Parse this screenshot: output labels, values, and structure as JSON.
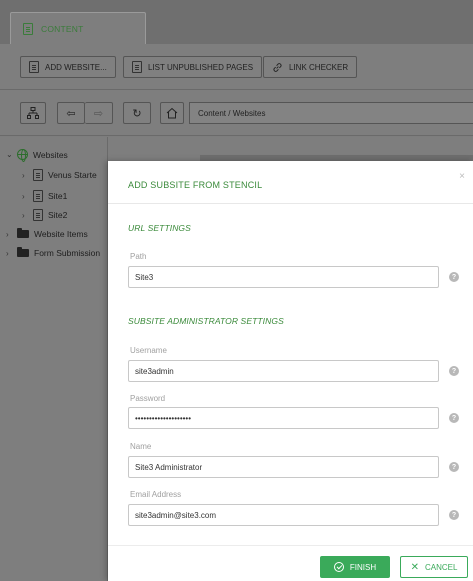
{
  "tabs": [
    {
      "label": "CONTENT"
    }
  ],
  "toolbar": {
    "add_website": "ADD WEBSITE...",
    "list_unpublished": "LIST UNPUBLISHED PAGES",
    "link_checker": "LINK CHECKER"
  },
  "breadcrumb": "Content / Websites",
  "tree": {
    "root": "Websites",
    "children": [
      "Venus Starte",
      "Site1",
      "Site2"
    ],
    "others": [
      "Website Items",
      "Form Submission"
    ]
  },
  "modal": {
    "title": "ADD SUBSITE FROM STENCIL",
    "close": "×",
    "url_section": "URL SETTINGS",
    "admin_section": "SUBSITE ADMINISTRATOR SETTINGS",
    "fields": {
      "path": {
        "label": "Path",
        "value": "Site3"
      },
      "username": {
        "label": "Username",
        "value": "site3admin"
      },
      "password": {
        "label": "Password",
        "value": "••••••••••••••••••••"
      },
      "name": {
        "label": "Name",
        "value": "Site3 Administrator"
      },
      "email": {
        "label": "Email Address",
        "value": "site3admin@site3.com"
      }
    },
    "help_glyph": "?",
    "finish": "FINISH",
    "cancel": "CANCEL"
  },
  "colors": {
    "accent": "#3aaa5a",
    "title_green": "#3a8a3a",
    "overlay": "#7e7e7e"
  }
}
